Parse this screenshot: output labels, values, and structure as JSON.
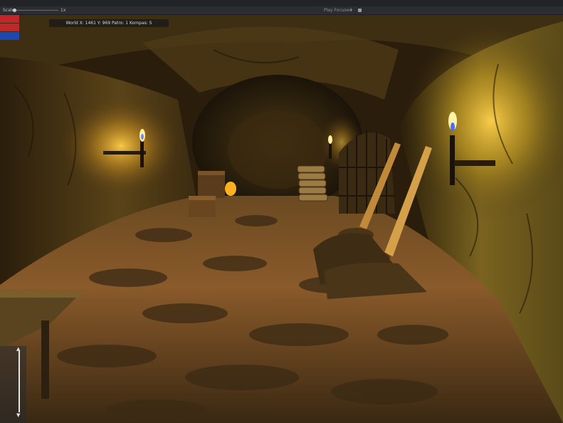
{
  "toolbar": {
    "scale_label": "Scale",
    "scale_value": "1x",
    "play_mode_label": "Play Focused"
  },
  "hud": {
    "status_text": "World X: 1461 Y: 969 Patro: 1 Kompas: S"
  },
  "swatches": {
    "colors": [
      "#c0262a",
      "#c0262a",
      "#1d47b5"
    ]
  },
  "icons": {
    "zoom_up": "arrow-up-icon",
    "zoom_down": "arrow-down-icon",
    "dropdown": "chevron-down-icon"
  }
}
